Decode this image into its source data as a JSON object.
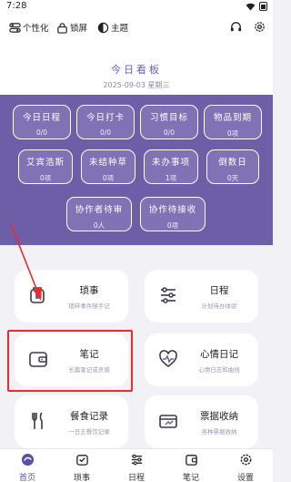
{
  "status_bar": {
    "time": "7:28"
  },
  "toolbar": {
    "personalize_label": "个性化",
    "lock_label": "锁屏",
    "theme_label": "主题"
  },
  "board": {
    "title": "今日看板",
    "date": "2025-09-03  星期三"
  },
  "stats": [
    {
      "title": "今日日程",
      "value": "0/0"
    },
    {
      "title": "今日打卡",
      "value": "0/0"
    },
    {
      "title": "习惯目标",
      "value": "0/0"
    },
    {
      "title": "物品到期",
      "value": "0项"
    },
    {
      "title": "艾宾浩斯",
      "value": "0项"
    },
    {
      "title": "未结种草",
      "value": "0项"
    },
    {
      "title": "未办事项",
      "value": "1项"
    },
    {
      "title": "倒数日",
      "value": "0天"
    },
    {
      "title": "协作者待审",
      "value": "0人"
    },
    {
      "title": "协作待接收",
      "value": "0项"
    }
  ],
  "cards": [
    {
      "title": "琐事",
      "sub": "琐碎事件随手记"
    },
    {
      "title": "日程",
      "sub": "计划待办体验"
    },
    {
      "title": "笔记",
      "sub": "长篇笔记或灵感"
    },
    {
      "title": "心情日记",
      "sub": "心情日志和曲线"
    },
    {
      "title": "餐食记录",
      "sub": "一日五餐饮记录"
    },
    {
      "title": "票据收纳",
      "sub": "各种票据收纳"
    }
  ],
  "tabs": [
    {
      "label": "首页"
    },
    {
      "label": "琐事"
    },
    {
      "label": "日程"
    },
    {
      "label": "笔记"
    },
    {
      "label": "设置"
    }
  ],
  "colors": {
    "accent": "#6c5fa8",
    "highlight": "#ee2a2a"
  }
}
